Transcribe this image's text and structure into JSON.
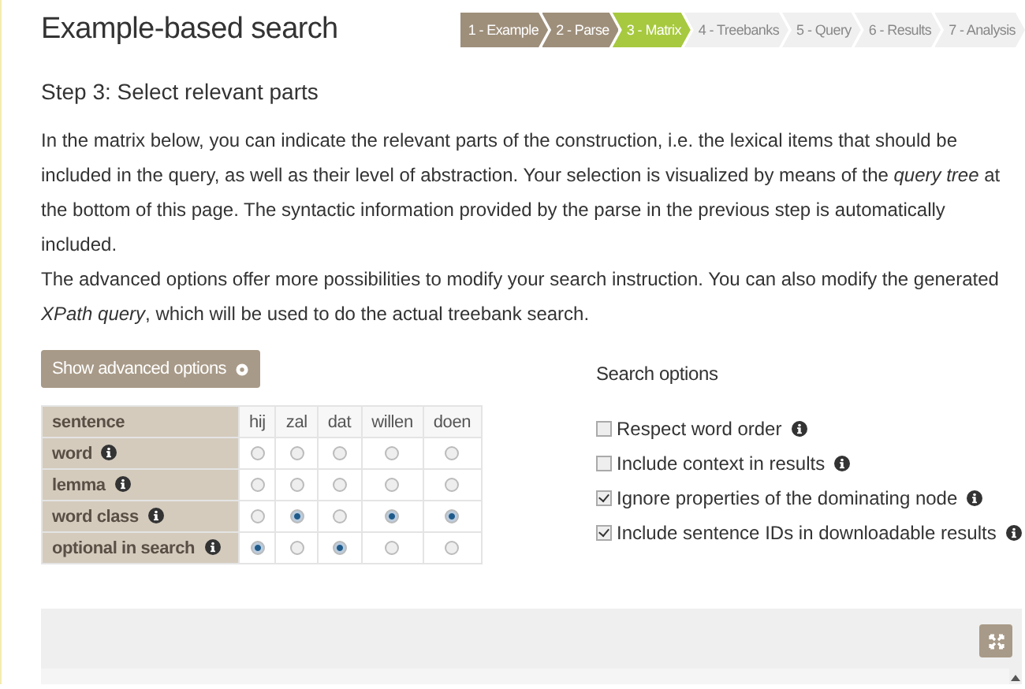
{
  "title": "Example-based search",
  "steps": [
    {
      "label": "1 - Example",
      "selected": false,
      "done": true
    },
    {
      "label": "2 - Parse",
      "selected": false,
      "done": true
    },
    {
      "label": "3 - Matrix",
      "selected": true,
      "done": false
    },
    {
      "label": "4 - Treebanks",
      "selected": false,
      "done": false
    },
    {
      "label": "5 - Query",
      "selected": false,
      "done": false
    },
    {
      "label": "6 - Results",
      "selected": false,
      "done": false
    },
    {
      "label": "7 - Analysis",
      "selected": false,
      "done": false
    }
  ],
  "heading": "Step 3: Select relevant parts",
  "paragraphs": [
    "In the matrix below, you can indicate the relevant parts of the construction, i.e. the lexical items that should be included in the query, as well as their level of abstraction. Your selection is visualized by means of the *query tree* at the bottom of this page. The syntactic information provided by the parse in the previous step is automatically included.",
    "The advanced options offer more possibilities to modify your search instruction. You can also modify the generated *XPath query*, which will be used to do the actual treebank search."
  ],
  "advanced_button": "Show advanced options",
  "matrix": {
    "header": "sentence",
    "words": [
      "hij",
      "zal",
      "dat",
      "willen",
      "doen"
    ],
    "rows": [
      {
        "label": "word",
        "cells": [
          {
            "selected": false
          },
          {
            "selected": false
          },
          {
            "selected": false
          },
          {
            "selected": false
          },
          {
            "selected": false
          }
        ]
      },
      {
        "label": "lemma",
        "cells": [
          {
            "selected": false
          },
          {
            "selected": false
          },
          {
            "selected": false
          },
          {
            "selected": false
          },
          {
            "selected": false
          }
        ]
      },
      {
        "label": "word class",
        "cells": [
          {
            "selected": false
          },
          {
            "selected": true
          },
          {
            "selected": false
          },
          {
            "selected": true
          },
          {
            "selected": true
          }
        ]
      },
      {
        "label": "optional in search",
        "cells": [
          {
            "selected": true
          },
          {
            "selected": false
          },
          {
            "selected": true
          },
          {
            "selected": false
          },
          {
            "selected": false
          }
        ]
      }
    ]
  },
  "search_options": {
    "title": "Search options",
    "options": [
      {
        "label": "Respect word order",
        "checked": false
      },
      {
        "label": "Include context in results",
        "checked": false
      },
      {
        "label": "Ignore properties of the dominating node",
        "checked": true
      },
      {
        "label": "Include sentence IDs in downloadable results",
        "checked": true
      }
    ]
  }
}
